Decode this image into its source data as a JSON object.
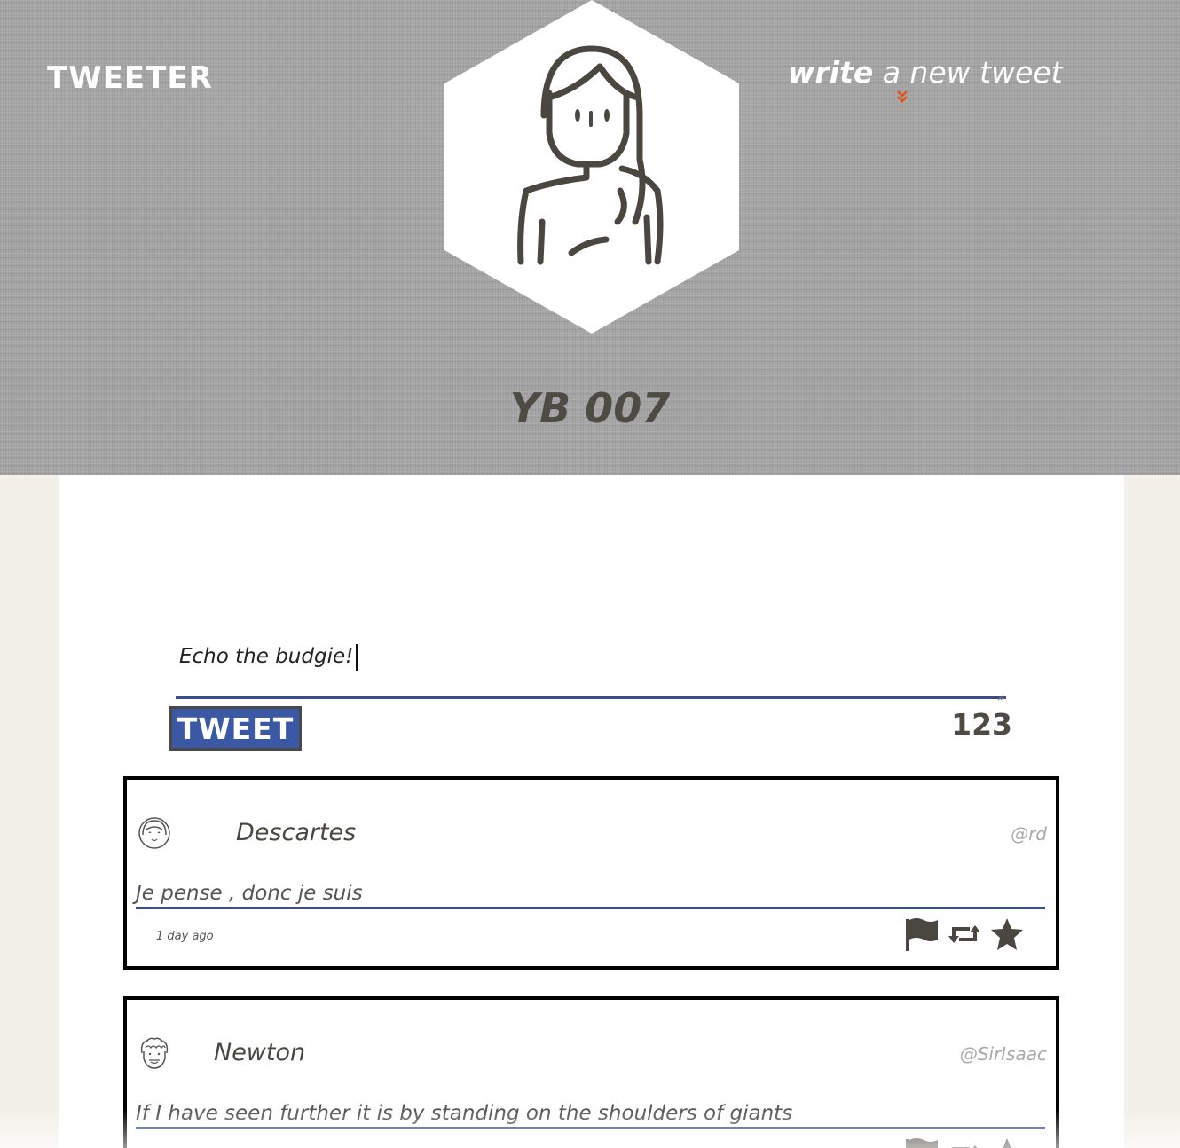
{
  "header": {
    "logo": "TWEETER",
    "compose_toggle": {
      "bold": "write",
      "rest": " a new tweet"
    },
    "username": "YB 007",
    "accent_color": "#e0531c"
  },
  "composer": {
    "text": "Echo the budgie!",
    "tweet_button_label": "TWEET",
    "char_counter": "123",
    "accent_color": "#3b58a4"
  },
  "tweets": [
    {
      "name": "Descartes",
      "handle": "@rd",
      "text": "Je pense , donc je suis",
      "time": "1 day ago",
      "avatar_icon": "girl-face-icon"
    },
    {
      "name": "Newton",
      "handle": "@SirIsaac",
      "text": "If I have seen further it is by standing on the shoulders of giants",
      "time": "",
      "avatar_icon": "curly-hair-face-icon"
    }
  ],
  "icons": {
    "flag": "flag-icon",
    "retweet": "retweet-icon",
    "like": "star-icon"
  }
}
